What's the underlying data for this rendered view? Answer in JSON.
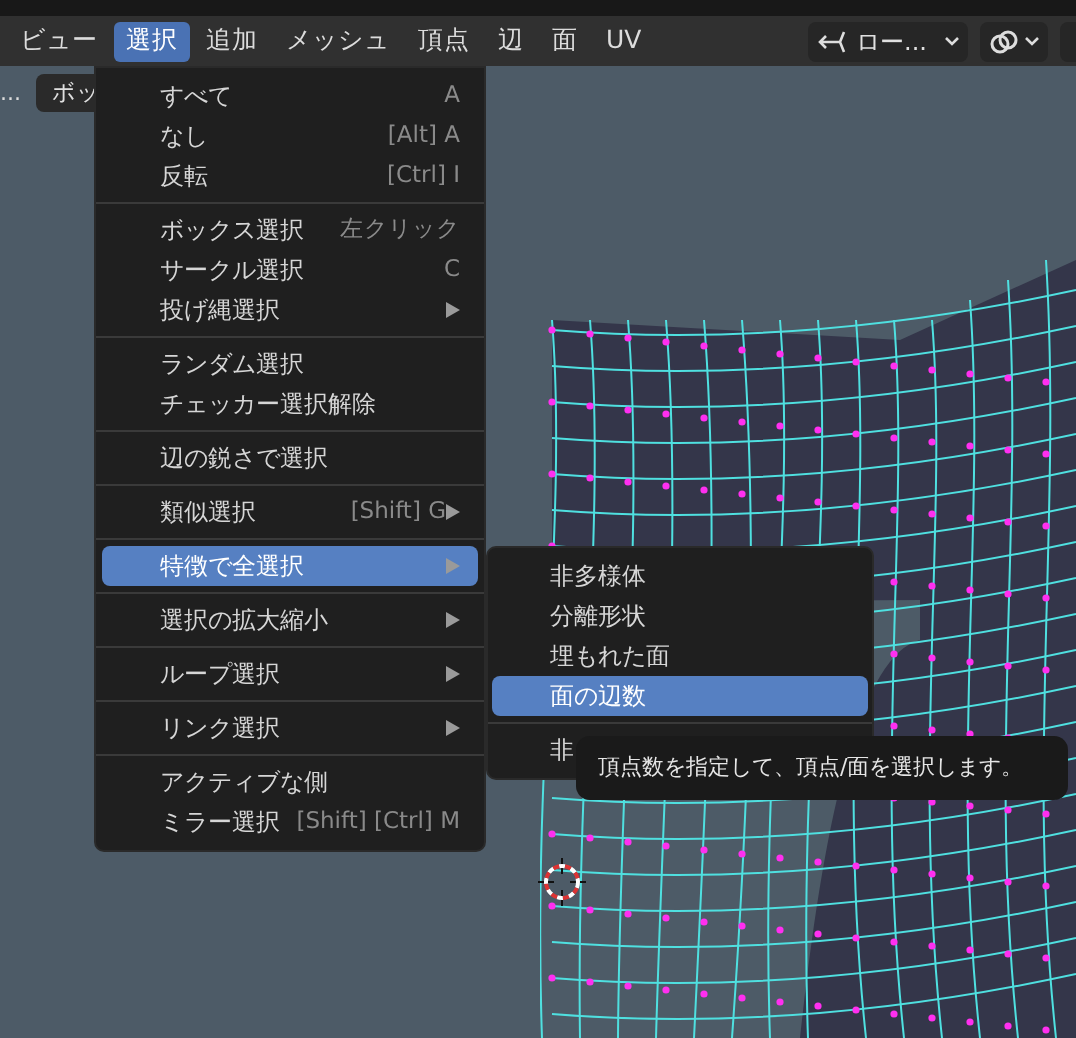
{
  "header_menu": [
    {
      "label": "ビュー",
      "selected": false
    },
    {
      "label": "選択",
      "selected": true
    },
    {
      "label": "追加",
      "selected": false
    },
    {
      "label": "メッシュ",
      "selected": false
    },
    {
      "label": "頂点",
      "selected": false
    },
    {
      "label": "辺",
      "selected": false
    },
    {
      "label": "面",
      "selected": false
    },
    {
      "label": "UV",
      "selected": false
    }
  ],
  "orientation_dropdown": {
    "value": "ロー..."
  },
  "viewport": {
    "ellipsis": "...",
    "tool_hint": "ボッ"
  },
  "select_menu": {
    "sections": [
      [
        {
          "label": "すべて",
          "shortcut": "A",
          "has_submenu": false,
          "selected": false
        },
        {
          "label": "なし",
          "shortcut": "[Alt] A",
          "has_submenu": false,
          "selected": false
        },
        {
          "label": "反転",
          "shortcut": "[Ctrl] I",
          "has_submenu": false,
          "selected": false
        }
      ],
      [
        {
          "label": "ボックス選択",
          "shortcut": "左クリック",
          "has_submenu": false,
          "selected": false
        },
        {
          "label": "サークル選択",
          "shortcut": "C",
          "has_submenu": false,
          "selected": false
        },
        {
          "label": "投げ縄選択",
          "has_submenu": true,
          "selected": false
        }
      ],
      [
        {
          "label": "ランダム選択",
          "has_submenu": false,
          "selected": false
        },
        {
          "label": "チェッカー選択解除",
          "has_submenu": false,
          "selected": false
        }
      ],
      [
        {
          "label": "辺の鋭さで選択",
          "has_submenu": false,
          "selected": false
        }
      ],
      [
        {
          "label": "類似選択",
          "shortcut": "[Shift] G",
          "has_submenu": true,
          "selected": false
        }
      ],
      [
        {
          "label": "特徴で全選択",
          "has_submenu": true,
          "selected": true
        }
      ],
      [
        {
          "label": "選択の拡大縮小",
          "has_submenu": true,
          "selected": false
        }
      ],
      [
        {
          "label": "ループ選択",
          "has_submenu": true,
          "selected": false
        }
      ],
      [
        {
          "label": "リンク選択",
          "has_submenu": true,
          "selected": false
        }
      ],
      [
        {
          "label": "アクティブな側",
          "has_submenu": false,
          "selected": false
        },
        {
          "label": "ミラー選択",
          "shortcut": "[Shift] [Ctrl] M",
          "has_submenu": false,
          "selected": false
        }
      ]
    ]
  },
  "submenu": {
    "sections": [
      [
        {
          "label": "非多様体",
          "selected": false
        },
        {
          "label": "分離形状",
          "selected": false
        },
        {
          "label": "埋もれた面",
          "selected": false
        },
        {
          "label": "面の辺数",
          "selected": true
        }
      ],
      [
        {
          "label": "非",
          "selected": false
        }
      ]
    ]
  },
  "tooltip": {
    "text": "頂点数を指定して、頂点/面を選択します。"
  }
}
